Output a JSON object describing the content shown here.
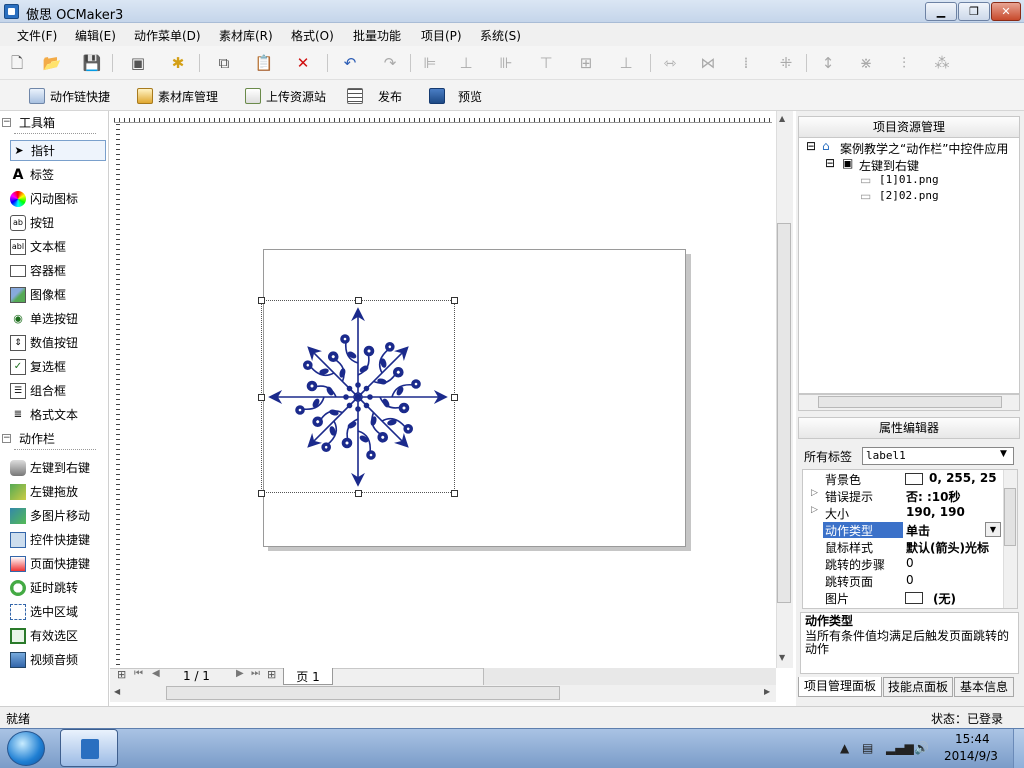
{
  "window": {
    "title": "傲思 OCMaker3",
    "min": "▁",
    "max": "❐",
    "close": "✕"
  },
  "menu": [
    "文件(F)",
    "编辑(E)",
    "动作菜单(D)",
    "素材库(R)",
    "格式(O)",
    "批量功能",
    "项目(P)",
    "系统(S)"
  ],
  "toolbar2": {
    "action_chain": "动作链快捷",
    "material": "素材库管理",
    "upload": "上传资源站",
    "publish": "发布",
    "preview": "预览"
  },
  "toolbox": {
    "title": "工具箱",
    "items": [
      "指针",
      "标签",
      "闪动图标",
      "按钮",
      "文本框",
      "容器框",
      "图像框",
      "单选按钮",
      "数值按钮",
      "复选框",
      "组合框",
      "格式文本"
    ],
    "action_title": "动作栏",
    "actions": [
      "左键到右键",
      "左键拖放",
      "多图片移动",
      "控件快捷键",
      "页面快捷键",
      "延时跳转",
      "选中区域",
      "有效选区",
      "视频音频"
    ]
  },
  "pagebar": {
    "page_count": "1 / 1",
    "tab": "页 1"
  },
  "resource": {
    "title": "项目资源管理",
    "root": "案例教学之“动作栏”中控件应用",
    "node": "左键到右键",
    "files": [
      "[1]01.png",
      "[2]02.png"
    ]
  },
  "properties": {
    "title": "属性编辑器",
    "all_label": "所有标签",
    "selected": "label1",
    "rows": [
      {
        "name": "背景色",
        "value": "0, 255, 25"
      },
      {
        "name": "错误提示",
        "value": "否: :10秒"
      },
      {
        "name": "大小",
        "value": "190, 190"
      },
      {
        "name": "动作类型",
        "value": "单击"
      },
      {
        "name": "鼠标样式",
        "value": "默认(箭头)光标"
      },
      {
        "name": "跳转的步骤",
        "value": "0"
      },
      {
        "name": "跳转页面",
        "value": "0"
      },
      {
        "name": "图片",
        "value": "(无)"
      }
    ],
    "desc_title": "动作类型",
    "desc_text": "当所有条件值均满足后触发页面跳转的动作"
  },
  "right_tabs": [
    "项目管理面板",
    "技能点面板",
    "基本信息"
  ],
  "status": {
    "left": "就绪",
    "right": "状态：已登录"
  },
  "taskbar": {
    "time": "15:44",
    "date": "2014/9/3"
  },
  "colors": {
    "accent": "#1f7fd3",
    "flower": "#1b2a8c",
    "selection_bg": "#3b71c9"
  }
}
